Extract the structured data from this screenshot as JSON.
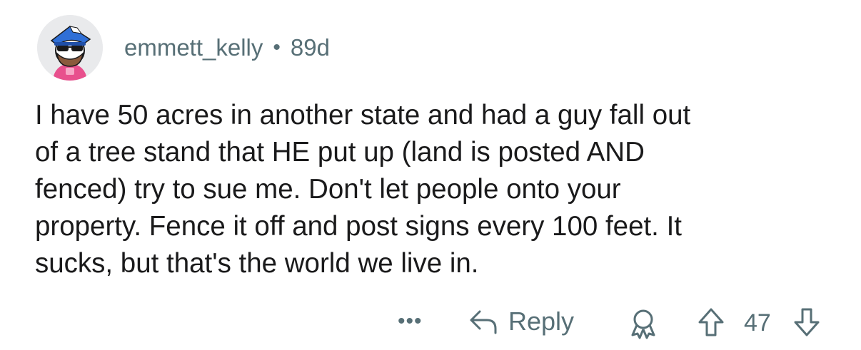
{
  "comment": {
    "author": "emmett_kelly",
    "separator": "•",
    "age": "89d",
    "body": "I have 50 acres in another state and had a guy fall out\nof a tree stand that HE put up (land is posted AND\nfenced) try to sue me. Don't let people onto your\nproperty. Fence it off and post signs every 100 feet. It\nsucks, but that's the world we live in."
  },
  "actions": {
    "more_label": "•••",
    "reply_label": "Reply",
    "score": "47",
    "icons": {
      "reply": "reply-arrow-icon",
      "award": "award-icon",
      "upvote": "upvote-arrow-icon",
      "downvote": "downvote-arrow-icon"
    }
  },
  "colors": {
    "meta_text": "#576f76",
    "body_text": "#1a1a1b",
    "avatar_bg": "#e9eaec"
  }
}
